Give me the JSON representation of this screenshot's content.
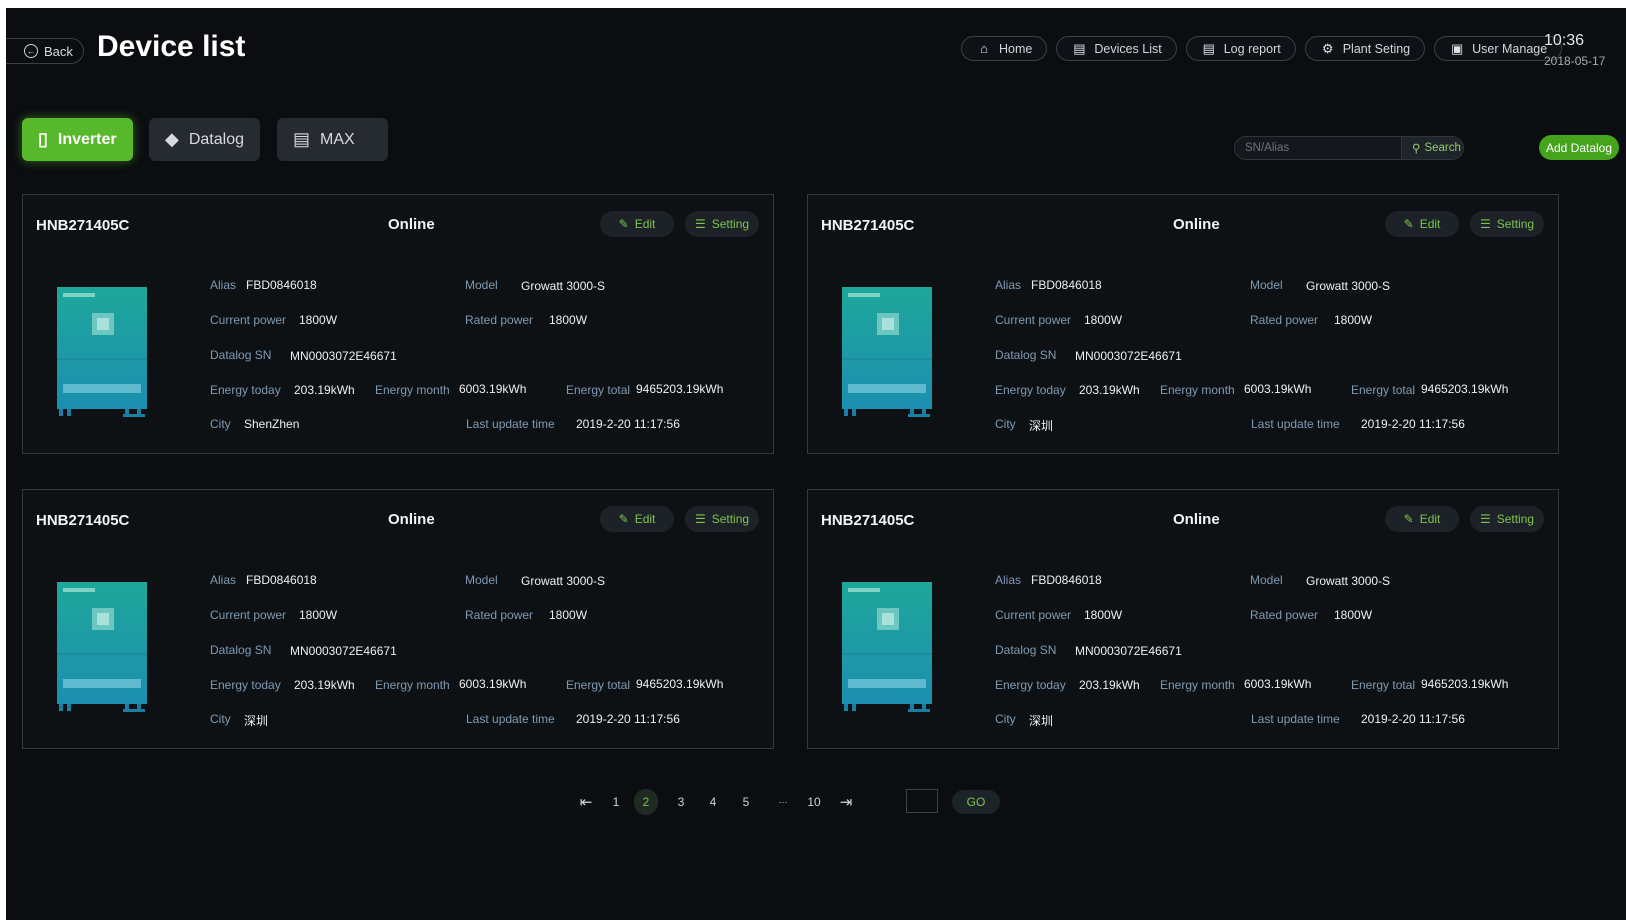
{
  "header": {
    "back_label": "Back",
    "title": "Device list",
    "nav": [
      {
        "label": "Home",
        "icon": "home-icon"
      },
      {
        "label": "Devices List",
        "icon": "devices-icon"
      },
      {
        "label": "Log report",
        "icon": "report-icon"
      },
      {
        "label": "Plant Seting",
        "icon": "gear-icon"
      },
      {
        "label": "User Manage",
        "icon": "user-card-icon"
      }
    ],
    "time": "10:36",
    "date": "2018-05-17"
  },
  "tabs": [
    {
      "label": "Inverter",
      "icon": "inverter-icon",
      "active": true
    },
    {
      "label": "Datalog",
      "icon": "datalog-icon",
      "active": false
    },
    {
      "label": "MAX",
      "icon": "max-icon",
      "active": false
    }
  ],
  "search": {
    "placeholder": "SN/Alias",
    "button": "Search"
  },
  "add_button": "Add Datalog",
  "labels": {
    "alias": "Alias",
    "model": "Model",
    "current_power": "Current power",
    "rated_power": "Rated power",
    "datalog_sn": "Datalog SN",
    "energy_today": "Energy today",
    "energy_month": "Energy month",
    "energy_total": "Energy total",
    "city": "City",
    "last_update": "Last update time",
    "edit": "Edit",
    "setting": "Setting"
  },
  "devices": [
    {
      "sn": "HNB271405C",
      "status": "Online",
      "alias": "FBD0846018",
      "model": "Growatt 3000-S",
      "current_power": "1800W",
      "rated_power": "1800W",
      "datalog_sn": "MN0003072E46671",
      "energy_today": "203.19kWh",
      "energy_month": "6003.19kWh",
      "energy_total": "9465203.19kWh",
      "city": "ShenZhen",
      "last_update": "2019-2-20 11:17:56"
    },
    {
      "sn": "HNB271405C",
      "status": "Online",
      "alias": "FBD0846018",
      "model": "Growatt 3000-S",
      "current_power": "1800W",
      "rated_power": "1800W",
      "datalog_sn": "MN0003072E46671",
      "energy_today": "203.19kWh",
      "energy_month": "6003.19kWh",
      "energy_total": "9465203.19kWh",
      "city": "深圳",
      "last_update": "2019-2-20 11:17:56"
    },
    {
      "sn": "HNB271405C",
      "status": "Online",
      "alias": "FBD0846018",
      "model": "Growatt 3000-S",
      "current_power": "1800W",
      "rated_power": "1800W",
      "datalog_sn": "MN0003072E46671",
      "energy_today": "203.19kWh",
      "energy_month": "6003.19kWh",
      "energy_total": "9465203.19kWh",
      "city": "深圳",
      "last_update": "2019-2-20 11:17:56"
    },
    {
      "sn": "HNB271405C",
      "status": "Online",
      "alias": "FBD0846018",
      "model": "Growatt 3000-S",
      "current_power": "1800W",
      "rated_power": "1800W",
      "datalog_sn": "MN0003072E46671",
      "energy_today": "203.19kWh",
      "energy_month": "6003.19kWh",
      "energy_total": "9465203.19kWh",
      "city": "深圳",
      "last_update": "2019-2-20 11:17:56"
    }
  ],
  "pagination": {
    "pages": [
      "1",
      "2",
      "3",
      "4",
      "5",
      "···",
      "10"
    ],
    "current": "2",
    "first_icon": "first-page-icon",
    "last_icon": "last-page-icon",
    "go_label": "GO"
  },
  "colors": {
    "accent": "#58b82c",
    "background": "#0b0d10",
    "label": "#7e9ab4"
  }
}
